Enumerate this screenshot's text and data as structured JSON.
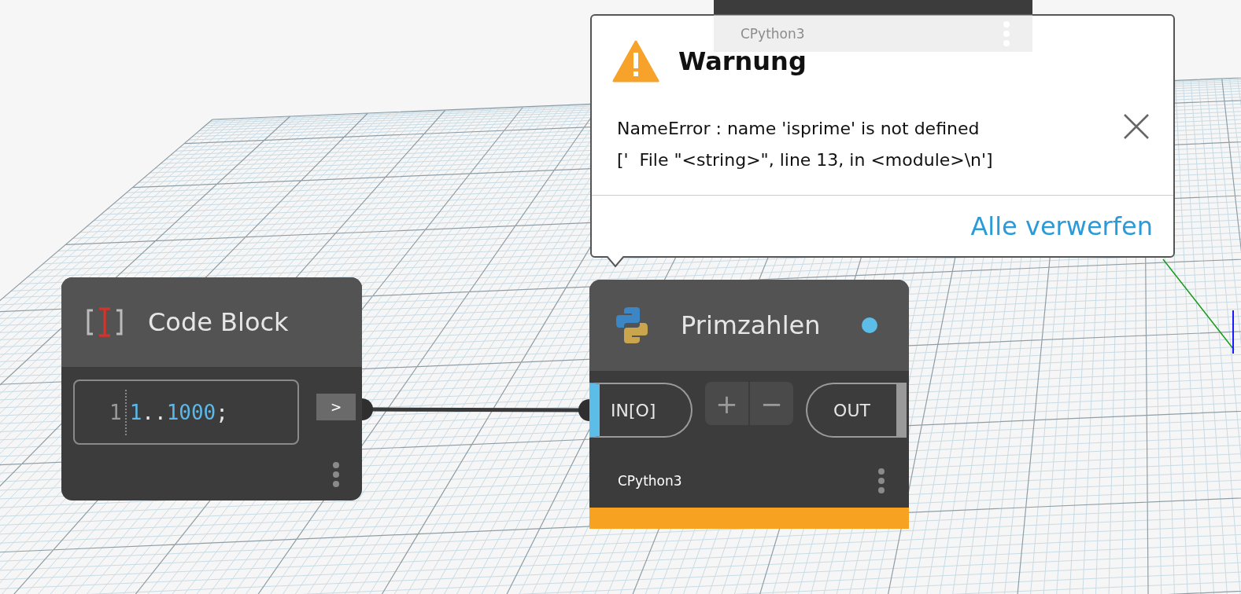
{
  "background_node": {
    "footer": "CPython3"
  },
  "warning": {
    "title": "Warnung",
    "lines": [
      "NameError : name 'isprime' is not defined",
      "['  File \"<string>\", line 13, in <module>\\n']"
    ],
    "action": "Alle verwerfen"
  },
  "nodes": [
    {
      "kind": "code",
      "title": "Code Block",
      "line_number": "1",
      "code": [
        {
          "text": "1",
          "kind": "number"
        },
        {
          "text": "..",
          "kind": "operator"
        },
        {
          "text": "1000",
          "kind": "number"
        },
        {
          "text": ";",
          "kind": "operator"
        }
      ],
      "output_button": ">"
    },
    {
      "kind": "python",
      "title": "Primzahlen",
      "input": "IN[O]",
      "add": "+",
      "remove": "−",
      "output": "OUT",
      "footer": "CPython3",
      "warning": true
    }
  ]
}
